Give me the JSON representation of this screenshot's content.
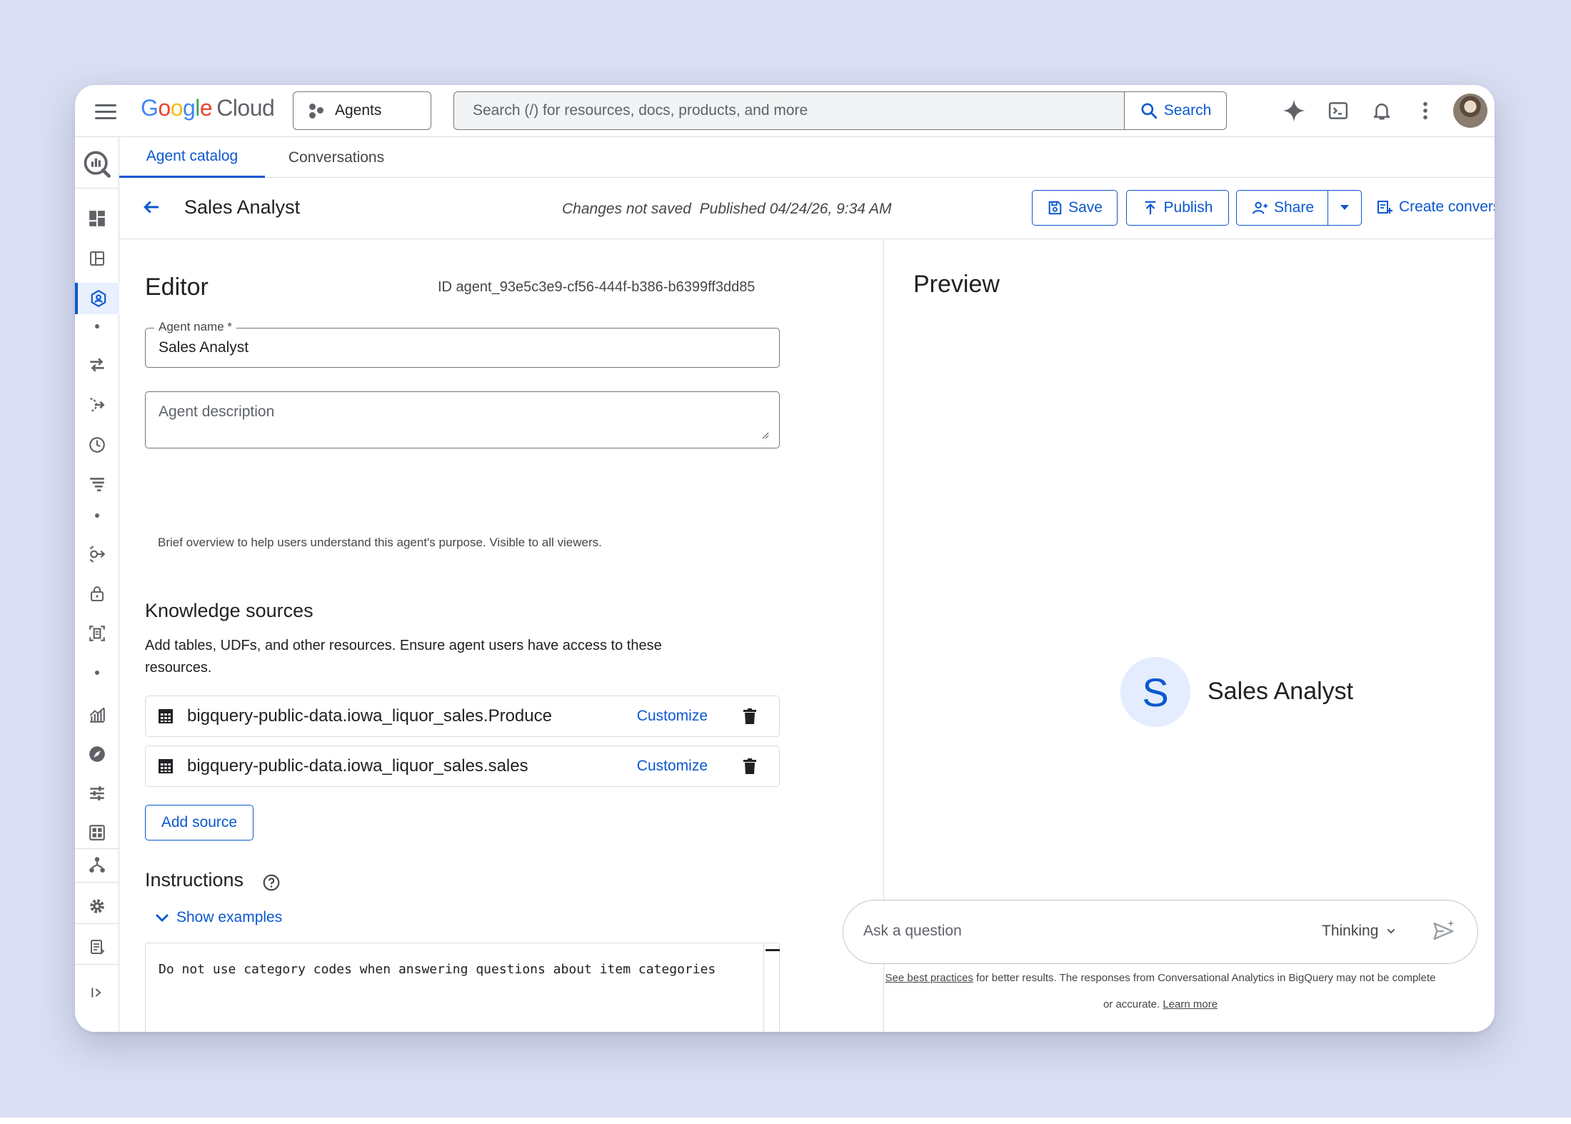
{
  "topbar": {
    "logo_google": "Google",
    "logo_cloud": "Cloud",
    "agents_label": "Agents",
    "search_placeholder": "Search (/) for resources, docs, products, and more",
    "search_button": "Search"
  },
  "tabs": [
    {
      "label": "Agent catalog",
      "active": true
    },
    {
      "label": "Conversations",
      "active": false
    }
  ],
  "header": {
    "title": "Sales Analyst",
    "status": "Changes not saved  Published 04/24/26, 9:34 AM",
    "save_label": "Save",
    "publish_label": "Publish",
    "share_label": "Share",
    "create_label": "Create conversation"
  },
  "editor": {
    "title": "Editor",
    "id_text": "ID agent_93e5c3e9-cf56-444f-b386-b6399ff3dd85",
    "agent_name_label": "Agent name *",
    "agent_name_value": "Sales Analyst",
    "agent_description_placeholder": "Agent description",
    "description_hint": "Brief overview to help users understand this agent's purpose. Visible to all viewers.",
    "knowledge_title": "Knowledge sources",
    "knowledge_desc": "Add tables, UDFs, and other resources. Ensure agent users have access to these resources.",
    "sources": [
      {
        "name": "bigquery-public-data.iowa_liquor_sales.Produce",
        "action": "Customize"
      },
      {
        "name": "bigquery-public-data.iowa_liquor_sales.sales",
        "action": "Customize"
      }
    ],
    "add_source_label": "Add source",
    "instructions_title": "Instructions",
    "show_examples_label": "Show examples",
    "instructions_text": "Do not use category codes when answering questions about item categories"
  },
  "preview": {
    "title": "Preview",
    "avatar_letter": "S",
    "agent_name": "Sales Analyst",
    "ask_placeholder": "Ask a question",
    "mode_label": "Thinking",
    "disclaimer_link1": "See best practices",
    "disclaimer_text1": " for better results. The responses from Conversational Analytics in BigQuery may not be complete",
    "disclaimer_text2": "or accurate. ",
    "disclaimer_link2": "Learn more"
  },
  "colors": {
    "accent": "#0b57d0",
    "page_background": "#d9def2",
    "border": "#dadce0"
  }
}
